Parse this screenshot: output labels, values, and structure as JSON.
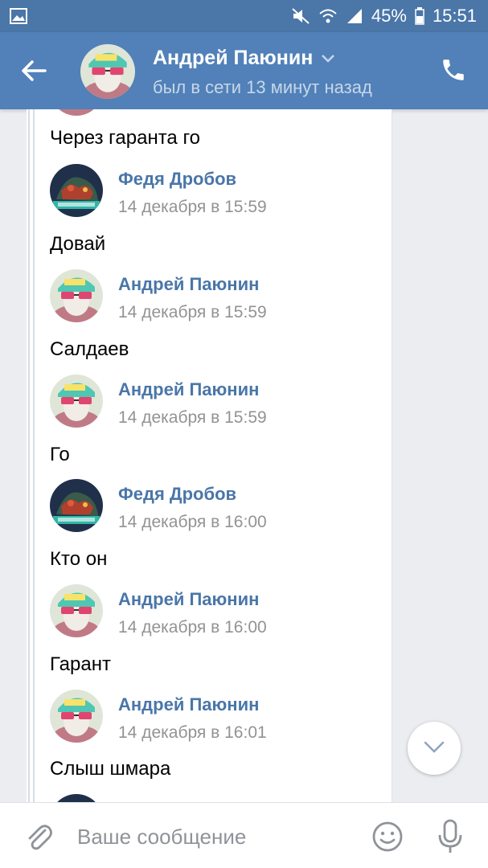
{
  "status_bar": {
    "battery": "45%",
    "time": "15:51"
  },
  "header": {
    "contact_name": "Андрей Паюнин",
    "status": "был в сети 13 минут назад"
  },
  "messages": [
    {
      "kind": "text",
      "text": "Через гаранта го"
    },
    {
      "kind": "header",
      "author": "Федя Дробов",
      "date": "14 декабря в 15:59",
      "avatar": "andrei"
    },
    {
      "kind": "text",
      "text": "Довай"
    },
    {
      "kind": "header",
      "author": "Андрей Паюнин",
      "date": "14 декабря в 15:59",
      "avatar": "andrei"
    },
    {
      "kind": "text",
      "text": "Салдаев"
    },
    {
      "kind": "header",
      "author": "Андрей Паюнин",
      "date": "14 декабря в 15:59",
      "avatar": "andrei"
    },
    {
      "kind": "text",
      "text": "Го"
    },
    {
      "kind": "header",
      "author": "Федя Дробов",
      "date": "14 декабря в 16:00",
      "avatar": "fedya"
    },
    {
      "kind": "text",
      "text": "Кто он"
    },
    {
      "kind": "header",
      "author": "Андрей Паюнин",
      "date": "14 декабря в 16:00",
      "avatar": "andrei"
    },
    {
      "kind": "text",
      "text": "Гарант"
    },
    {
      "kind": "header",
      "author": "Андрей Паюнин",
      "date": "14 декабря в 16:01",
      "avatar": "andrei"
    },
    {
      "kind": "text",
      "text": "Слыш шмара"
    }
  ],
  "composer": {
    "placeholder": "Ваше сообщение"
  },
  "colors": {
    "header_bg": "#5181b8",
    "status_bar_bg": "#4a76a8",
    "author_name": "#4a76a8",
    "date_text": "#939393"
  }
}
